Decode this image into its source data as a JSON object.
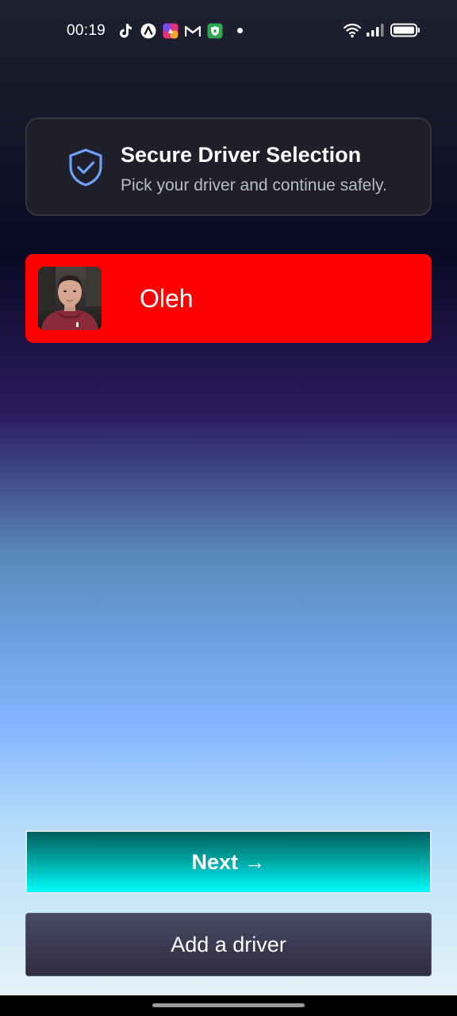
{
  "status_bar": {
    "time": "00:19",
    "app_icons": [
      "tiktok-icon",
      "arc-icon",
      "photos-icon",
      "gmail-icon",
      "vpn-shield-icon"
    ],
    "system_icons": [
      "wifi-icon",
      "signal-icon",
      "battery-icon"
    ]
  },
  "header": {
    "title": "Secure Driver Selection",
    "subtitle": "Pick your driver and continue safely.",
    "icon": "shield-check-icon",
    "icon_color": "#6ea0f5"
  },
  "drivers": [
    {
      "name": "Oleh",
      "selected": true,
      "highlight_color": "#ff0000"
    }
  ],
  "actions": {
    "next_label": "Next →",
    "add_driver_label": "Add a driver"
  },
  "colors": {
    "selected_driver": "#ff0000",
    "next_button_top": "#00605e",
    "next_button_bottom": "#00ffff",
    "add_button": "#3a3950"
  }
}
